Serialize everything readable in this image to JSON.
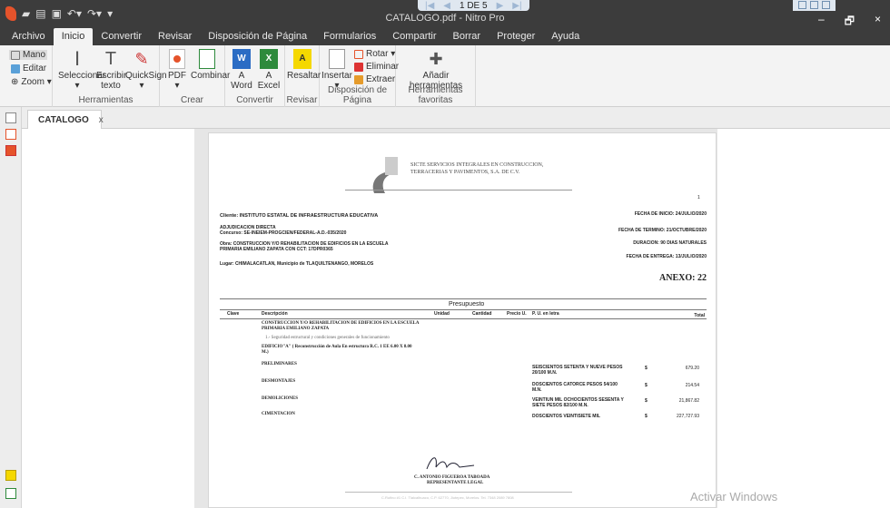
{
  "titlebar": {
    "doc_title": "CATALOGO.pdf - Nitro Pro",
    "page_indicator": "1 DE 5",
    "minimize": "–",
    "restore": "🗗",
    "close": "×"
  },
  "menu": {
    "tabs": [
      "Archivo",
      "Inicio",
      "Convertir",
      "Revisar",
      "Disposición de Página",
      "Formularios",
      "Compartir",
      "Borrar",
      "Proteger",
      "Ayuda"
    ]
  },
  "ribbon": {
    "mano": "Mano",
    "editar": "Editar",
    "zoom": "Zoom ▾",
    "seleccionar": "Seleccionar",
    "escribir": "Escribir texto",
    "quicksign": "QuickSign",
    "herramientas": "Herramientas",
    "pdf": "PDF",
    "combinar": "Combinar",
    "crear": "Crear",
    "a_word_1": "A",
    "a_word_2": "Word",
    "a_excel_1": "A",
    "a_excel_2": "Excel",
    "convertir": "Convertir",
    "resaltar": "Resaltar",
    "revisar": "Revisar",
    "insertar": "Insertar",
    "rotar": "Rotar ▾",
    "eliminar": "Eliminar",
    "extraer": "Extraer",
    "disposicion": "Disposición de Página",
    "anadir_1": "Añadir",
    "anadir_2": "herramientas",
    "favoritas": "Herramientas favoritas"
  },
  "doc_tab": {
    "name": "CATALOGO",
    "close": "x"
  },
  "document": {
    "company_1": "SICTE SERVICIOS INTEGRALES EN CONSTRUCCION,",
    "company_2": "TERRACERIAS Y PAVIMENTOS, S.A. DE C.V.",
    "page_num": "1",
    "cliente": "Cliente: INSTITUTO ESTATAL DE INFRAESTRUCTURA EDUCATIVA",
    "fecha_inicio": "FECHA DE INICIO: 24/JULIO/2020",
    "adjudicacion": "ADJUDICACION DIRECTA",
    "concurso": "Concurso: SE-INEIEM-PROGCIEN/FEDERAL-A.D.-035/2020",
    "fecha_termino": "FECHA DE TERMINO: 21/OCTUBRE/2020",
    "obra_1": "Obra: CONSTRUCCION Y/O REHABILITACION DE EDIFICIOS EN LA ESCUELA",
    "obra_2": "PRIMARIA EMILIANO ZAPATA CON CCT: 17DPR0365",
    "duracion": "DURACION: 90 DIAS NATURALES",
    "fecha_entrega": "FECHA DE ENTREGA: 13/JULIO/2020",
    "lugar": "Lugar: CHIMALACATLAN, Municipio de TLAQUILTENANGO, MORELOS",
    "anexo": "ANEXO: 22",
    "presupuesto": "Presupuesto",
    "col_clave": "Clave",
    "col_desc": "Descripción",
    "col_unidad": "Unidad",
    "col_cantidad": "Cantidad",
    "col_precio": "Precio U.",
    "col_pu_letra": "P. U. en letra",
    "col_total": "Total",
    "desc_1": "CONSTRUCCION Y/O REHABILITACION DE EDIFICIOS EN LA ESCUELA",
    "desc_2": "PRIMARIA EMILIANO ZAPATA",
    "desc_3": "1.- Seguridad estructural y condiciones generales de funcionamiento",
    "desc_4": "EDIFICIO\"A\" ( Reconstrucción de Aula En estructura R.C. 1 EE 6.00 X 8.00",
    "desc_5": "M.)",
    "rows": [
      {
        "name": "PRELIMINARES",
        "letra_1": "SEISCIENTOS SETENTA Y NUEVE PESOS",
        "letra_2": "20/100 M.N.",
        "cur": "$",
        "total": "679.20"
      },
      {
        "name": "DESMONTAJES",
        "letra_1": "DOSCIENTOS CATORCE PESOS 54/100",
        "letra_2": "M.N.",
        "cur": "$",
        "total": "214.54"
      },
      {
        "name": "DEMOLICIONES",
        "letra_1": "VEINTIUN MIL OCHOCIENTOS SESENTA Y",
        "letra_2": "SIETE PESOS 82/100 M.N.",
        "cur": "$",
        "total": "21,867.82"
      },
      {
        "name": "CIMENTACION",
        "letra_1": "DOSCIENTOS VEINTISIETE MIL",
        "letra_2": "",
        "cur": "$",
        "total": "227,727.93"
      }
    ],
    "signer_1": "C. ANTONIO FIGUEROA TABOADA",
    "signer_2": "REPRESENTANTE LEGAL",
    "footer": "C.Rufino #1 C.I. Tlalcalhuaco, C.P. 62770, Jiutepec, Morelos. Tel. 7348 2089 7808"
  },
  "watermark": "Activar Windows"
}
